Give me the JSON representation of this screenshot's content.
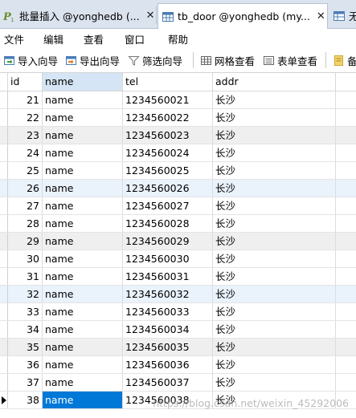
{
  "tabs": [
    {
      "label": "批量插入 @yonghedb (...",
      "close": "✕",
      "icon": "query-icon"
    },
    {
      "label": "tb_door @yonghedb (my...",
      "close": "✕",
      "icon": "table-icon"
    },
    {
      "label": "无",
      "icon": "table-icon"
    }
  ],
  "menu": [
    "文件",
    "编辑",
    "查看",
    "窗口",
    "帮助"
  ],
  "toolbar": {
    "import": "导入向导",
    "export": "导出向导",
    "filter": "筛选向导",
    "grid_view": "网格查看",
    "form_view": "表单查看",
    "memo": "备"
  },
  "columns": [
    "id",
    "name",
    "tel",
    "addr"
  ],
  "rows": [
    {
      "id": "21",
      "name": "name",
      "tel": "1234560021",
      "addr": "长沙"
    },
    {
      "id": "22",
      "name": "name",
      "tel": "1234560022",
      "addr": "长沙"
    },
    {
      "id": "23",
      "name": "name",
      "tel": "1234560023",
      "addr": "长沙"
    },
    {
      "id": "24",
      "name": "name",
      "tel": "1234560024",
      "addr": "长沙"
    },
    {
      "id": "25",
      "name": "name",
      "tel": "1234560025",
      "addr": "长沙"
    },
    {
      "id": "26",
      "name": "name",
      "tel": "1234560026",
      "addr": "长沙"
    },
    {
      "id": "27",
      "name": "name",
      "tel": "1234560027",
      "addr": "长沙"
    },
    {
      "id": "28",
      "name": "name",
      "tel": "1234560028",
      "addr": "长沙"
    },
    {
      "id": "29",
      "name": "name",
      "tel": "1234560029",
      "addr": "长沙"
    },
    {
      "id": "30",
      "name": "name",
      "tel": "1234560030",
      "addr": "长沙"
    },
    {
      "id": "31",
      "name": "name",
      "tel": "1234560031",
      "addr": "长沙"
    },
    {
      "id": "32",
      "name": "name",
      "tel": "1234560032",
      "addr": "长沙"
    },
    {
      "id": "33",
      "name": "name",
      "tel": "1234560033",
      "addr": "长沙"
    },
    {
      "id": "34",
      "name": "name",
      "tel": "1234560034",
      "addr": "长沙"
    },
    {
      "id": "35",
      "name": "name",
      "tel": "1234560035",
      "addr": "长沙"
    },
    {
      "id": "36",
      "name": "name",
      "tel": "1234560036",
      "addr": "长沙"
    },
    {
      "id": "37",
      "name": "name",
      "tel": "1234560037",
      "addr": "长沙"
    },
    {
      "id": "38",
      "name": "name",
      "tel": "1234560038",
      "addr": "长沙"
    }
  ],
  "selected_row_id": "38",
  "watermark": "https://blog.csdn.net/weixin_45292006",
  "colors": {
    "selection": "#0078d7",
    "tab_bar": "#dbe3ee",
    "header_selected": "#d5e5f5"
  }
}
